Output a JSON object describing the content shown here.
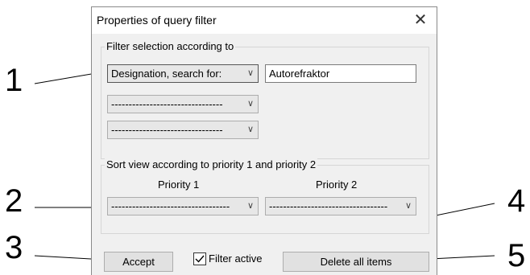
{
  "dialog": {
    "title": "Properties of query filter",
    "close_glyph": "✕"
  },
  "filter_group": {
    "label": "Filter selection according to",
    "criteria": [
      {
        "selected": "Designation, search for:",
        "value": "Autorefraktor"
      },
      {
        "selected": "--------------------------------"
      },
      {
        "selected": "--------------------------------"
      }
    ]
  },
  "sort_group": {
    "label": "Sort view according to priority 1 and priority 2",
    "priority1_label": "Priority 1",
    "priority2_label": "Priority 2",
    "priority1_selected": "----------------------------------",
    "priority2_selected": "----------------------------------"
  },
  "buttons": {
    "accept": "Accept",
    "filter_active": "Filter active",
    "filter_active_checked": true,
    "delete_all": "Delete all items"
  },
  "callouts": [
    "1",
    "2",
    "3",
    "4",
    "5"
  ]
}
